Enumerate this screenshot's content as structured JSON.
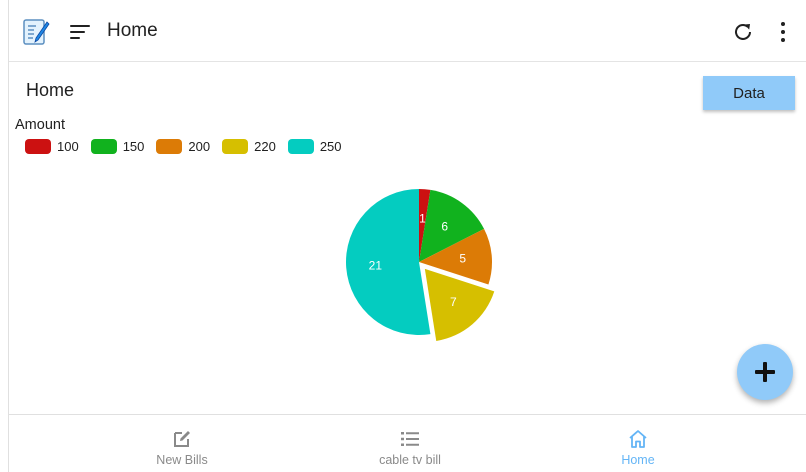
{
  "appbar": {
    "title": "Home",
    "icons": [
      "notes-app-icon",
      "menu-icon",
      "refresh-icon",
      "more-vert-icon"
    ]
  },
  "page": {
    "title": "Home",
    "data_button_label": "Data"
  },
  "legend": {
    "title": "Amount",
    "items": [
      {
        "label": "100",
        "color": "#cc1111"
      },
      {
        "label": "150",
        "color": "#11b21e"
      },
      {
        "label": "200",
        "color": "#dc7b06"
      },
      {
        "label": "220",
        "color": "#d6bf00"
      },
      {
        "label": "250",
        "color": "#04ccc0"
      }
    ]
  },
  "chart_data": {
    "type": "pie",
    "title": "",
    "legend_title": "Amount",
    "categories": [
      "100",
      "150",
      "200",
      "220",
      "250"
    ],
    "values": [
      1,
      6,
      5,
      7,
      21
    ],
    "colors": [
      "#cc1111",
      "#11b21e",
      "#dc7b06",
      "#d6bf00",
      "#04ccc0"
    ],
    "exploded": "220",
    "legend_position": "top-left"
  },
  "fab": {
    "icon": "plus-icon"
  },
  "bottom_nav": {
    "items": [
      {
        "label": "New Bills",
        "icon": "edit-icon",
        "active": false
      },
      {
        "label": "cable tv bill",
        "icon": "list-icon",
        "active": false
      },
      {
        "label": "Home",
        "icon": "home-icon",
        "active": true
      }
    ]
  },
  "colors": {
    "accent": "#90caf9",
    "active_nav": "#64b5f6",
    "inactive_nav": "#8a8a8a"
  }
}
